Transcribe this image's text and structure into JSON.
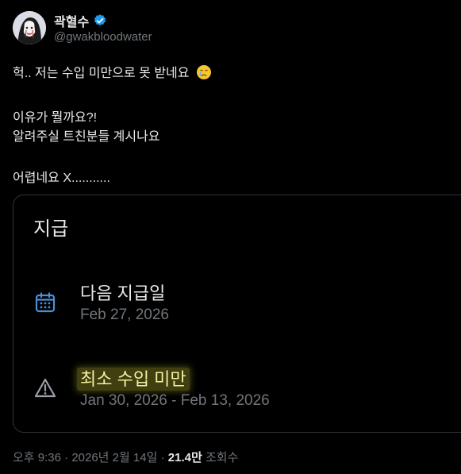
{
  "author": {
    "name": "곽혈수",
    "handle": "@gwakbloodwater",
    "verified_color": "#1d9bf0"
  },
  "tweet": {
    "line1": "헉.. 저는 수입 미만으로 못 받네요",
    "line1_emoji": "crying-face-icon",
    "line2": "이유가 뭘까요?!",
    "line3": "알려주실 트친분들 계시나요",
    "line4": "어렵네요 X..........."
  },
  "card": {
    "title": "지급",
    "next_payment": {
      "label": "다음 지급일",
      "date": "Feb 27, 2026",
      "icon": "calendar-icon"
    },
    "min_income": {
      "label": "최소 수입 미만",
      "range": "Jan 30, 2026 - Feb 13, 2026",
      "icon": "warning-icon"
    }
  },
  "meta": {
    "time": "오후 9:36",
    "date": "2026년 2월 14일",
    "views_count": "21.4만",
    "views_label": "조회수"
  }
}
